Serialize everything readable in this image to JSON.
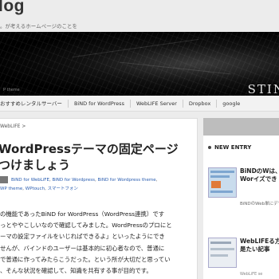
{
  "header": {
    "title": "log",
    "description": "。が考えるホームページのことを"
  },
  "banner": {
    "caption": "P theme",
    "logo_text": "STIN"
  },
  "nav": {
    "items": [
      "おすすめレンタルサーバー",
      "BiND for WordPress",
      "WebLIFE Server",
      "Dropbox",
      "google"
    ]
  },
  "breadcrumb": "WebLIFE >",
  "post": {
    "title": "WordPressテーマの固定ページ\nつけましょう",
    "tags": [
      "BiND for WebLiFE",
      "BiND for Wordpress",
      "BiND for Wordpress theme",
      "WP theme",
      "WPtouch",
      "スマートフォン"
    ],
    "body": "の機能であったBiND for WordPress（WordPress連携）です\nっとややこしいなので確認してみました。WordPressのプロにと\nーマの設定ファイルをいじればできるよ」といったようにでき\nせんが、バインドのユーザーは基本的に初心者なので、普通に\nで普通に作ってみたらこうだった。という所が大切だと思ってい\n、そんな状況を確認して、知識を共有する事が目的です。"
  },
  "sidebar": {
    "heading": "NEW ENTRY",
    "entries": [
      {
        "title": "BiNDのWは、Worイズでき よ",
        "excerpt": "BiNDのWeb単にデザイ"
      },
      {
        "title": "WebLIFEる方に是たい記事",
        "date": "WebLiFE se"
      }
    ]
  },
  "colors": {
    "background": "#ececec",
    "banner": "#000000",
    "link": "#2a5db0",
    "sidebar_bar": "#bdbdbd"
  }
}
